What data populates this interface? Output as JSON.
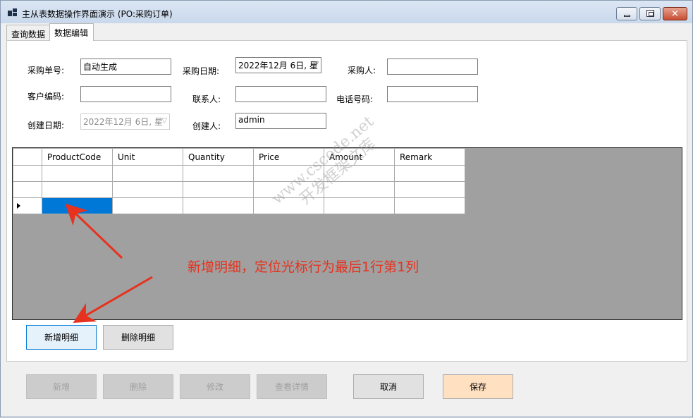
{
  "window": {
    "title": "主从表数据操作界面演示 (PO:采购订单)",
    "close_glyph": "✕"
  },
  "tabs": [
    {
      "label": "查询数据",
      "selected": false
    },
    {
      "label": "数据编辑",
      "selected": true
    }
  ],
  "form": {
    "po_number": {
      "label": "采购单号:",
      "value": "自动生成"
    },
    "purchase_date": {
      "label": "采购日期:",
      "value": "2022年12月  6日, 星"
    },
    "purchaser": {
      "label": "采购人:",
      "value": ""
    },
    "customer_code": {
      "label": "客户编码:",
      "value": ""
    },
    "contact": {
      "label": "联系人:",
      "value": ""
    },
    "phone": {
      "label": "电话号码:",
      "value": ""
    },
    "create_date": {
      "label": "创建日期:",
      "value": "2022年12月  6日, 星"
    },
    "creator": {
      "label": "创建人:",
      "value": "admin"
    }
  },
  "grid": {
    "columns": [
      "ProductCode",
      "Unit",
      "Quantity",
      "Price",
      "Amount",
      "Remark"
    ],
    "rows": [
      [
        "",
        "",
        "",
        "",
        "",
        ""
      ],
      [
        "",
        "",
        "",
        "",
        "",
        ""
      ],
      [
        "",
        "",
        "",
        "",
        "",
        ""
      ]
    ],
    "current_row": 2,
    "selected_col": 0
  },
  "detail_buttons": {
    "add": "新增明细",
    "delete": "删除明细"
  },
  "bottom_buttons": {
    "new": "新增",
    "delete": "删除",
    "edit": "修改",
    "view": "查看详情",
    "cancel": "取消",
    "save": "保存"
  },
  "overlay": {
    "watermark_line1": "www.cscode.net",
    "watermark_line2": "开发框架文库",
    "annotation": "新增明细，定位光标行为最后1行第1列",
    "annotation_color": "#e6321e"
  },
  "colors": {
    "selection": "#0078d7",
    "grid_background": "#a0a0a0",
    "save_button": "#ffe0c0"
  }
}
